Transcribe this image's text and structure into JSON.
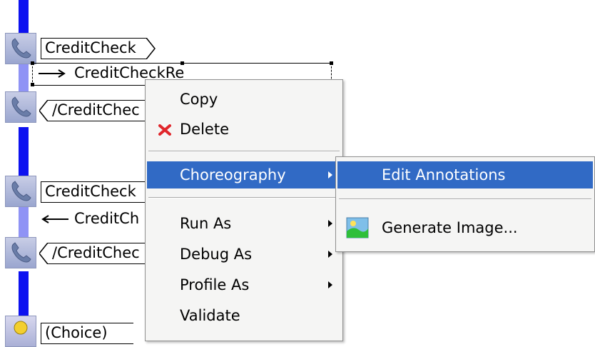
{
  "diagram": {
    "rows": [
      {
        "text": "CreditCheck",
        "kind": "tag"
      },
      {
        "text": "CreditCheckRe",
        "kind": "arrow-right"
      },
      {
        "text": "/CreditChec",
        "kind": "tag-end"
      },
      {
        "text": "CreditCheck",
        "kind": "tag"
      },
      {
        "text": "CreditCh",
        "kind": "arrow-left"
      },
      {
        "text": "/CreditChec",
        "kind": "tag-end"
      },
      {
        "text": "(Choice)",
        "kind": "tag"
      }
    ]
  },
  "context_menu": {
    "items": [
      {
        "label": "Copy",
        "icon": ""
      },
      {
        "label": "Delete",
        "icon": "delete-x-icon",
        "icon_color": "#e0262b"
      },
      {
        "label": "Choreography",
        "submenu": true,
        "highlighted": true
      },
      {
        "label": "Run As",
        "submenu": true
      },
      {
        "label": "Debug As",
        "submenu": true
      },
      {
        "label": "Profile As",
        "submenu": true
      },
      {
        "label": "Validate"
      }
    ]
  },
  "submenu": {
    "items": [
      {
        "label": "Edit Annotations",
        "highlighted": true
      },
      {
        "label": "Generate Image...",
        "icon": "image-icon"
      }
    ]
  },
  "colors": {
    "highlight": "#316ac5",
    "lifeline": "#0d11f0",
    "lifeline_light": "#8f93f5",
    "menu_bg": "#f5f5f4"
  }
}
